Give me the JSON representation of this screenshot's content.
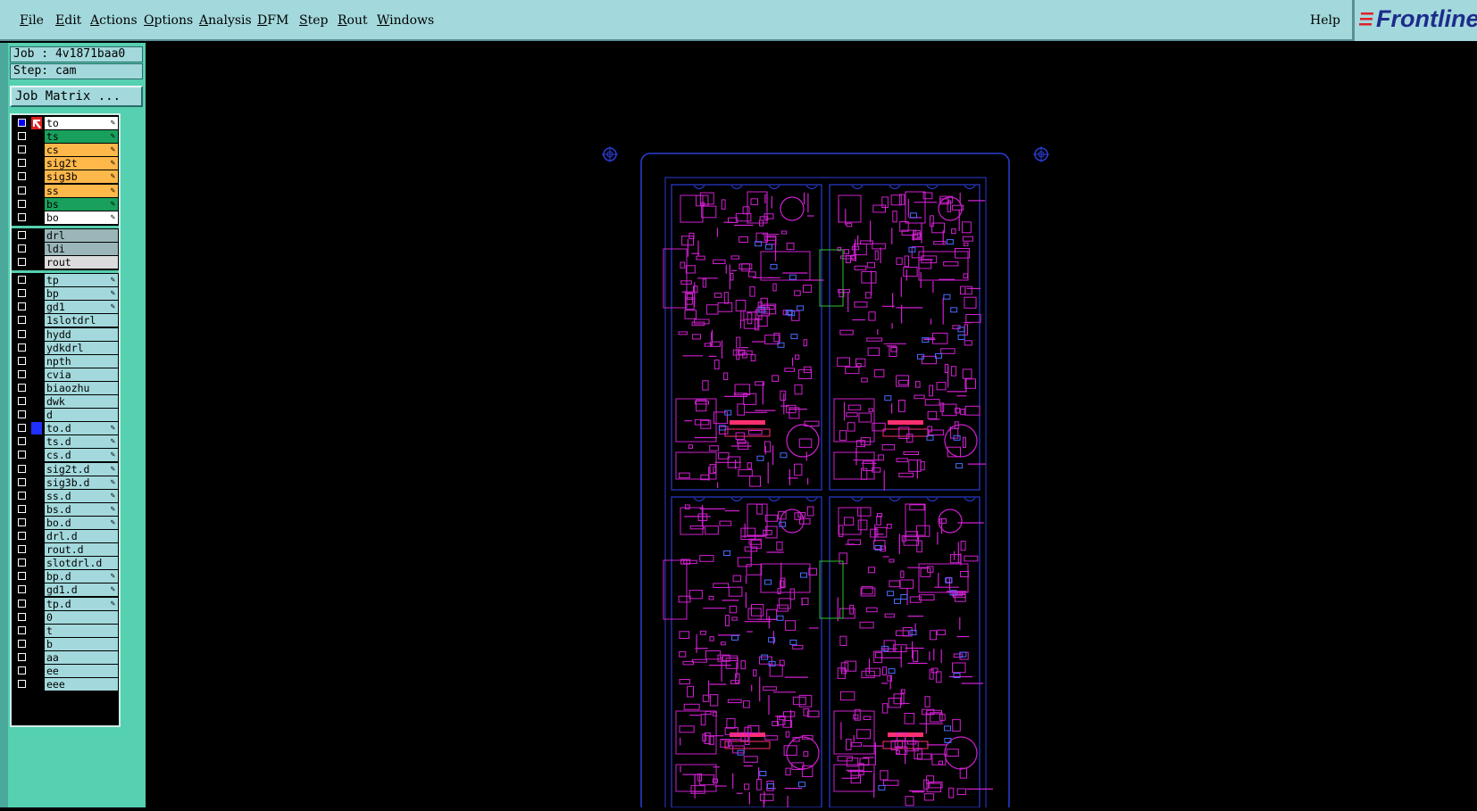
{
  "menu": {
    "items": [
      "File",
      "Edit",
      "Actions",
      "Options",
      "Analysis",
      "DFM",
      "Step",
      "Rout",
      "Windows"
    ],
    "help": "Help"
  },
  "logo": {
    "text": "Frontline"
  },
  "job": {
    "job_line": "Job : 4v1871baa0",
    "step_line": "Step: cam",
    "matrix_button": "Job Matrix ..."
  },
  "layers": [
    {
      "name": "to",
      "color": "#ffffff",
      "checked": true,
      "mark": "arrow",
      "editable": true
    },
    {
      "name": "ts",
      "color": "#19a05c",
      "editable": true
    },
    {
      "name": "cs",
      "color": "#ffb84a",
      "editable": true
    },
    {
      "name": "sig2t",
      "color": "#ffb84a",
      "editable": true
    },
    {
      "name": "sig3b",
      "color": "#ffb84a",
      "editable": true
    },
    {
      "name": "ss",
      "color": "#ffb84a",
      "editable": true
    },
    {
      "name": "bs",
      "color": "#19a05c",
      "editable": true
    },
    {
      "name": "bo",
      "color": "#ffffff",
      "editable": true
    },
    {
      "name": "drl",
      "color": "#9ab6b8",
      "group": 2
    },
    {
      "name": "ldi",
      "color": "#9ab6b8"
    },
    {
      "name": "rout",
      "color": "#dcdcdc"
    },
    {
      "name": "tp",
      "color": "#a3d9dc",
      "group": 3,
      "editable": true
    },
    {
      "name": "bp",
      "color": "#a3d9dc",
      "editable": true
    },
    {
      "name": "gd1",
      "color": "#a3d9dc",
      "editable": true
    },
    {
      "name": "1slotdrl",
      "color": "#a3d9dc"
    },
    {
      "name": "hydd",
      "color": "#a3d9dc"
    },
    {
      "name": "ydkdrl",
      "color": "#a3d9dc"
    },
    {
      "name": "npth",
      "color": "#a3d9dc"
    },
    {
      "name": "cvia",
      "color": "#a3d9dc"
    },
    {
      "name": "biaozhu",
      "color": "#a3d9dc"
    },
    {
      "name": "dwk",
      "color": "#a3d9dc"
    },
    {
      "name": "d",
      "color": "#a3d9dc"
    },
    {
      "name": "to.d",
      "color": "#a3d9dc",
      "mark": "blue",
      "editable": true
    },
    {
      "name": "ts.d",
      "color": "#a3d9dc",
      "editable": true
    },
    {
      "name": "cs.d",
      "color": "#a3d9dc",
      "editable": true
    },
    {
      "name": "sig2t.d",
      "color": "#a3d9dc",
      "editable": true
    },
    {
      "name": "sig3b.d",
      "color": "#a3d9dc",
      "editable": true
    },
    {
      "name": "ss.d",
      "color": "#a3d9dc",
      "editable": true
    },
    {
      "name": "bs.d",
      "color": "#a3d9dc",
      "editable": true
    },
    {
      "name": "bo.d",
      "color": "#a3d9dc",
      "editable": true
    },
    {
      "name": "drl.d",
      "color": "#a3d9dc"
    },
    {
      "name": "rout.d",
      "color": "#a3d9dc"
    },
    {
      "name": "slotdrl.d",
      "color": "#a3d9dc"
    },
    {
      "name": "bp.d",
      "color": "#a3d9dc",
      "editable": true
    },
    {
      "name": "gd1.d",
      "color": "#a3d9dc",
      "editable": true
    },
    {
      "name": "tp.d",
      "color": "#a3d9dc",
      "editable": true
    },
    {
      "name": "0",
      "color": "#a3d9dc"
    },
    {
      "name": "t",
      "color": "#a3d9dc"
    },
    {
      "name": "b",
      "color": "#a3d9dc"
    },
    {
      "name": "aa",
      "color": "#a3d9dc"
    },
    {
      "name": "ee",
      "color": "#a3d9dc"
    },
    {
      "name": "eee",
      "color": "#a3d9dc"
    }
  ],
  "board": {
    "panel_outline_color": "#2a3dd6",
    "copper_color": "#d020d0",
    "component_color": "#ff3070",
    "highlight_color": "#30c030"
  }
}
